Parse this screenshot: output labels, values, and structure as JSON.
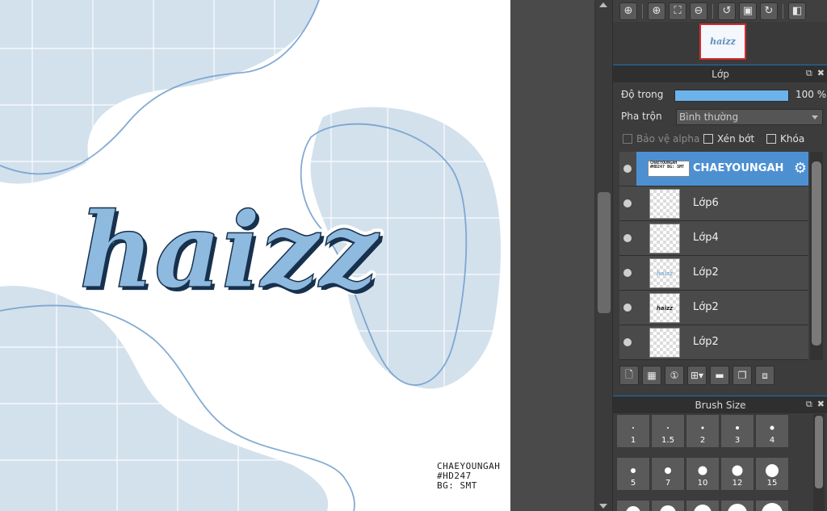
{
  "artwork": {
    "lettering": "haizz",
    "credit_lines": [
      "CHAEYOUNGAH",
      "#HD247",
      "BG: SMT"
    ]
  },
  "navigator": {
    "thumb_text": "haizz"
  },
  "toolbar": {
    "icons": [
      "zoom-actual-icon",
      "zoom-in-icon",
      "fit-icon",
      "zoom-out-icon",
      "rotate-left-icon",
      "fit-window-icon",
      "rotate-right-icon",
      "flip-icon"
    ]
  },
  "layer_panel": {
    "title": "Lớp",
    "opacity_label": "Độ trong",
    "opacity_value": "100 %",
    "opacity_fraction": 1.0,
    "blend_label": "Pha trộn",
    "blend_value": "Bình thường",
    "protect_alpha_label": "Bảo vệ alpha",
    "clipping_label": "Xén bớt",
    "lock_label": "Khóa",
    "layers": [
      {
        "name": "CHAEYOUNGAH",
        "selected": true,
        "thumb": "CHAEYOUNGAH #HD247 BG: SMT"
      },
      {
        "name": "Lớp6",
        "selected": false,
        "thumb": ""
      },
      {
        "name": "Lớp4",
        "selected": false,
        "thumb": ""
      },
      {
        "name": "Lớp2",
        "selected": false,
        "thumb": "haizz"
      },
      {
        "name": "Lớp2",
        "selected": false,
        "thumb": "haizz"
      },
      {
        "name": "Lớp2",
        "selected": false,
        "thumb": ""
      }
    ]
  },
  "brush_panel": {
    "title": "Brush Size",
    "sizes": [
      "1",
      "1.5",
      "2",
      "3",
      "4",
      "5",
      "7",
      "10",
      "12",
      "15"
    ]
  },
  "colors": {
    "accent_blue": "#4d90d1",
    "lettering_blue": "#8fbadf",
    "blob_blue": "#d3e1ed",
    "nav_highlight": "#d22a2a"
  }
}
